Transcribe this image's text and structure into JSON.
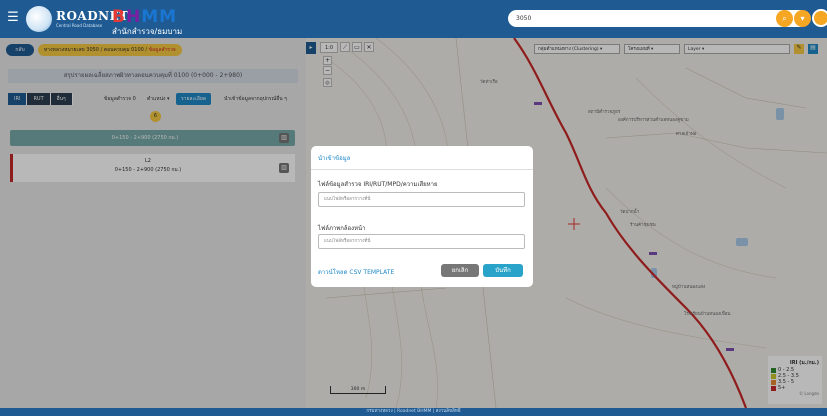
{
  "topbar": {
    "brand": "ROADNET",
    "brand_sub": "Central Road Database",
    "app": "BHMM",
    "app_b": "B",
    "app_h": "H",
    "app_mm": "MM",
    "dept": "สำนักสำรวจ/ธมบาม",
    "search_value": "3050",
    "search_icon": "search-icon",
    "filter_icon": "filter-icon"
  },
  "sidebar": {
    "back_label": "กลับ",
    "breadcrumb": "ทางหลวงหมายเลข 3050 / ตอนควบคุม 0100 / ",
    "breadcrumb_highlight": "ข้อมูลสำรวจ",
    "summary": "สรุปรายผลเฉลี่ยสภาพผิวทางตอนควบคุมที่ 0100 (0+000 - 2+980)",
    "tabs": [
      "IRI",
      "RUT",
      "อื่นๆ"
    ],
    "threshold_label": "ข้อมูลสำรวจ 0",
    "direction_select": "ตำแหน่ง",
    "detail_button": "รายละเอียด",
    "import_button": "นำเข้าข้อมูลจากอุปกรณ์อื่น ๆ",
    "count": "6",
    "segments": [
      {
        "line1": "0+150 - 2+900 (2750 กม.)",
        "line2": ""
      },
      {
        "line1": "L2",
        "line2": "0+150 - 2+900 (2750 กม.)"
      }
    ]
  },
  "map": {
    "layers_select": "กลุ่มตำแหน่งทาง (Clustering)",
    "base_select": "โครงแผนที่",
    "layer_select": "Layer",
    "zoom_in": "+",
    "zoom_out": "−",
    "zoom_level": "1:0",
    "pois": [
      "วัดท่าเรือ",
      "องค์การบริหารส่วนตำบลหนองคูขาม",
      "สถานีตำรวจภูธร",
      "ศาลเจ้าพ่อ",
      "วัดปากน้ำ",
      "ร้านค้าชุมชน",
      "หมู่บ้านหนองแสง",
      "โรงเรียนบ้านหนองเขื่อน"
    ],
    "scale": "300 m",
    "legend_title": "IRI (ม./กม.)",
    "legend": [
      {
        "label": "0 - 2.5",
        "color": "#2e8b2e"
      },
      {
        "label": "2.5 - 3.5",
        "color": "#c9c62a"
      },
      {
        "label": "3.5 - 5",
        "color": "#e68a2e"
      },
      {
        "label": "5+",
        "color": "#c62828"
      }
    ],
    "attribution": "© Longdo"
  },
  "modal": {
    "title": "นำเข้าข้อมูล",
    "field1_label": "ไฟล์ข้อมูลสำรวจ IRI/RUT/MPD/ความเสียหาย",
    "field1_placeholder": "แนบไฟล์หรือลากวางที่นี่",
    "field2_label": "ไฟล์ภาพกล้องหน้า",
    "field2_placeholder": "แนบไฟล์หรือลากวางที่นี่",
    "template_link": "ดาวน์โหลด CSV TEMPLATE",
    "cancel_label": "ยกเลิก",
    "save_label": "บันทึก"
  },
  "footer": {
    "text": "กรมทางหลวง | Roadnet BHMM | สงวนลิขสิทธิ์"
  },
  "colors": {
    "primary": "#1f5b92",
    "accent": "#1e88c7",
    "yellow": "#f5c842",
    "road": "#c62828"
  }
}
